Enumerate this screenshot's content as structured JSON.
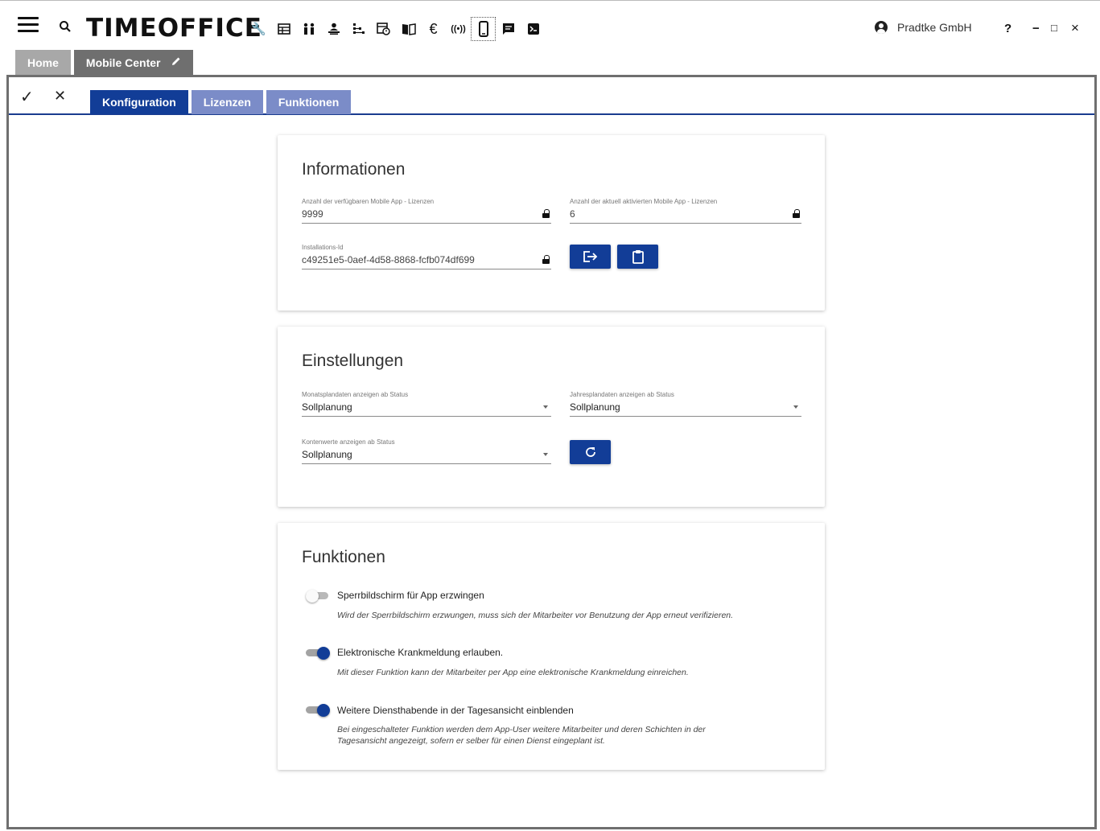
{
  "topbar": {
    "logo": "TIMEOFFICE",
    "user_name": "Pradtke GmbH",
    "help": "?",
    "minimize": "−",
    "maximize": "□",
    "close": "×",
    "nav_icons": [
      "wrench-icon",
      "calendar-grid-icon",
      "people-icon",
      "person-desk-icon",
      "org-tree-icon",
      "schedule-icon",
      "book-icon",
      "euro-icon",
      "radio-signal-icon",
      "mobile-icon",
      "message-icon",
      "terminal-icon"
    ]
  },
  "doc_tabs": {
    "home": "Home",
    "mobile_center": "Mobile Center"
  },
  "toolbar": {
    "confirm": "✓",
    "cancel": "✕"
  },
  "sub_tabs": {
    "konfiguration": "Konfiguration",
    "lizenzen": "Lizenzen",
    "funktionen": "Funktionen"
  },
  "informationen": {
    "title": "Informationen",
    "available_label": "Anzahl der verfügbaren Mobile App - Lizenzen",
    "available_value": "9999",
    "active_label": "Anzahl der aktuell aktivierten Mobile App - Lizenzen",
    "active_value": "6",
    "installation_label": "Installations-Id",
    "installation_value": "c49251e5-0aef-4d58-8868-fcfb074df699"
  },
  "einstellungen": {
    "title": "Einstellungen",
    "monthly_label": "Monatsplandaten anzeigen ab Status",
    "monthly_value": "Sollplanung",
    "yearly_label": "Jahresplandaten anzeigen ab Status",
    "yearly_value": "Sollplanung",
    "accounts_label": "Kontenwerte anzeigen ab Status",
    "accounts_value": "Sollplanung"
  },
  "funktionen": {
    "title": "Funktionen",
    "items": [
      {
        "label": "Sperrbildschirm für App erzwingen",
        "description": "Wird der Sperrbildschirm erzwungen, muss sich der Mitarbeiter vor Benutzung der App erneut verifizieren.",
        "enabled": false
      },
      {
        "label": "Elektronische Krankmeldung erlauben.",
        "description": "Mit dieser Funktion kann der Mitarbeiter per App eine elektronische Krankmeldung einreichen.",
        "enabled": true
      },
      {
        "label": "Weitere Diensthabende in der Tagesansicht einblenden",
        "description": "Bei eingeschalteter Funktion werden dem App-User weitere Mitarbeiter und deren Schichten in der Tagesansicht angezeigt, sofern er selber für einen Dienst eingeplant ist.",
        "enabled": true
      }
    ]
  },
  "colors": {
    "primary": "#123d97",
    "tab_inactive": "#7b8cc8",
    "doc_tab_active": "#6f6f6f",
    "doc_tab_home": "#a8a8a8"
  }
}
